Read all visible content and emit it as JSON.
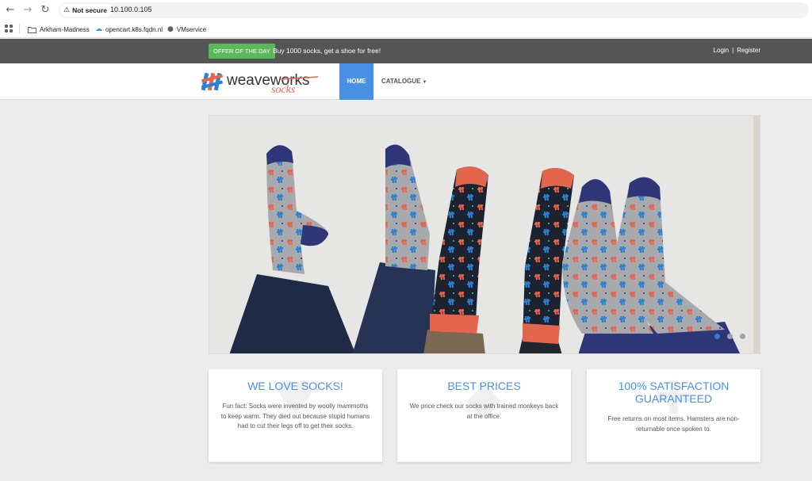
{
  "browser": {
    "security_label": "Not secure",
    "url": "10.100.0.105",
    "bookmarks": [
      {
        "label": "Arkham-Madness",
        "icon": "folder-icon"
      },
      {
        "label": "opencart.k8s.fqdn.nl",
        "icon": "cloud-icon"
      },
      {
        "label": "VMservice",
        "icon": "globe-icon"
      }
    ]
  },
  "topbar": {
    "offer_label": "Offer of the day",
    "offer_text": "Buy 1000 socks, get a shoe for free!",
    "login": "Login",
    "separator": "|",
    "register": "Register"
  },
  "navbar": {
    "logo_text_main": "weaveworks",
    "logo_text_sub": "socks",
    "home": "HOME",
    "catalogue": "CATALOGUE"
  },
  "carousel": {
    "slides": 3,
    "active_slide": 1
  },
  "cards": [
    {
      "title": "We love socks!",
      "text": "Fun fact: Socks were invented by woolly mammoths to keep warm. They died out because stupid humans had to cut their legs off to get their socks.",
      "icon": "heart-icon"
    },
    {
      "title": "Best prices",
      "text": "We price check our socks with trained monkeys back at the office.",
      "icon": "tag-icon"
    },
    {
      "title": "100% satisfaction guaranteed",
      "text": "Free returns on most items. Hamsters are non-returnable once spoken to.",
      "icon": "thumbs-up-icon"
    }
  ],
  "colors": {
    "accent": "#4a90e2",
    "offer": "#5cb85c",
    "topbar": "#555555",
    "sock_gray": "#a7a9ad",
    "sock_navy": "#2f3677",
    "sock_coral": "#e3654e",
    "sock_black": "#1c2230"
  }
}
